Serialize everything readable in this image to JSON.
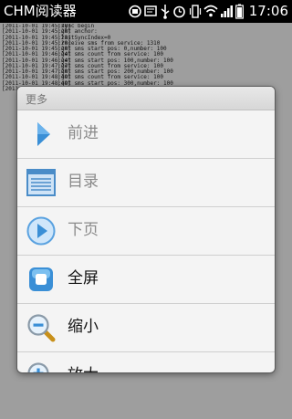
{
  "status_bar": {
    "app_title": "CHM阅读器",
    "time": "17:06",
    "icons": [
      "notification-icon",
      "sms-icon",
      "usb-icon",
      "alarm-icon",
      "vibrate-icon",
      "wifi-icon",
      "signal-icon",
      "battery-icon"
    ]
  },
  "log_lines": [
    {
      "ts": "[2011-10-01 19:45:28]",
      "msg": "sync begin"
    },
    {
      "ts": "[2011-10-01 19:45:28]",
      "msg": "get anchor:"
    },
    {
      "ts": "[2011-10-01 19:45:28]",
      "msg": "lastSyncIndex=0"
    },
    {
      "ts": "[2011-10-01 19:45:28]",
      "msg": "receive sms from service: 1310"
    },
    {
      "ts": "[2011-10-01 19:45:28]",
      "msg": "get sms start pos: 0,number: 100"
    },
    {
      "ts": "[2011-10-01 19:46:24]",
      "msg": "get sms count from service: 100"
    },
    {
      "ts": "[2011-10-01 19:46:24]",
      "msg": "get sms start pos: 100,number: 100"
    },
    {
      "ts": "[2011-10-01 19:47:27]",
      "msg": "get sms count from service: 100"
    },
    {
      "ts": "[2011-10-01 19:47:28]",
      "msg": "get sms start pos: 200,number: 100"
    },
    {
      "ts": "[2011-10-01 19:48:49]",
      "msg": "get sms count from service: 100"
    },
    {
      "ts": "[2011-10-01 19:48:49]",
      "msg": "get sms start pos: 300,number: 100"
    },
    {
      "ts": "[2011-10-01 19:50:51]",
      "msg": "get sms count from service: 100"
    }
  ],
  "menu": {
    "header": "更多",
    "items": [
      {
        "label": "前进",
        "icon": "forward-arrow-icon",
        "enabled": false
      },
      {
        "label": "目录",
        "icon": "toc-list-icon",
        "enabled": false
      },
      {
        "label": "下页",
        "icon": "next-page-icon",
        "enabled": false
      },
      {
        "label": "全屏",
        "icon": "fullscreen-icon",
        "enabled": true
      },
      {
        "label": "缩小",
        "icon": "zoom-out-icon",
        "enabled": true
      },
      {
        "label": "放大",
        "icon": "zoom-in-icon",
        "enabled": true
      }
    ]
  },
  "colors": {
    "icon_blue": "#3a8fd6",
    "disabled_label": "#8a8a8a",
    "enabled_label": "#111111"
  }
}
